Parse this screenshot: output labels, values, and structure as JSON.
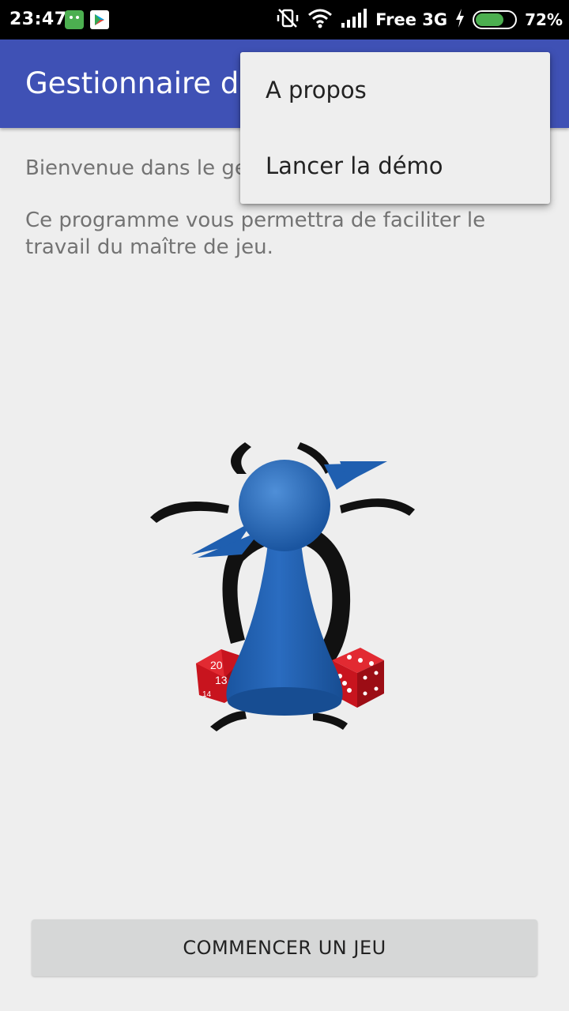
{
  "status_bar": {
    "time": "23:47",
    "carrier": "Free 3G",
    "battery_percent": "72%",
    "battery_level": 0.72,
    "icons": [
      "android-notification-icon",
      "play-store-icon",
      "vibrate-off-icon",
      "wifi-icon",
      "signal-icon",
      "charging-icon",
      "battery-icon"
    ]
  },
  "app_bar": {
    "title": "Gestionnaire de jeu"
  },
  "content": {
    "welcome": "Bienvenue dans le gestionnaire de jeu",
    "description": "Ce programme vous permettra de faciliter le travail du maître de jeu."
  },
  "logo": {
    "dice_labels": [
      "20",
      "13",
      "14"
    ]
  },
  "actions": {
    "start_button": "COMMENCER UN JEU"
  },
  "menu": {
    "items": [
      {
        "label": "A propos"
      },
      {
        "label": "Lancer la démo"
      }
    ]
  },
  "colors": {
    "primary": "#3f51b5",
    "status_bar": "#000000",
    "background": "#eeeeee",
    "pawn": "#1f5fb0",
    "dice": "#c8141e",
    "battery": "#4caf50"
  }
}
